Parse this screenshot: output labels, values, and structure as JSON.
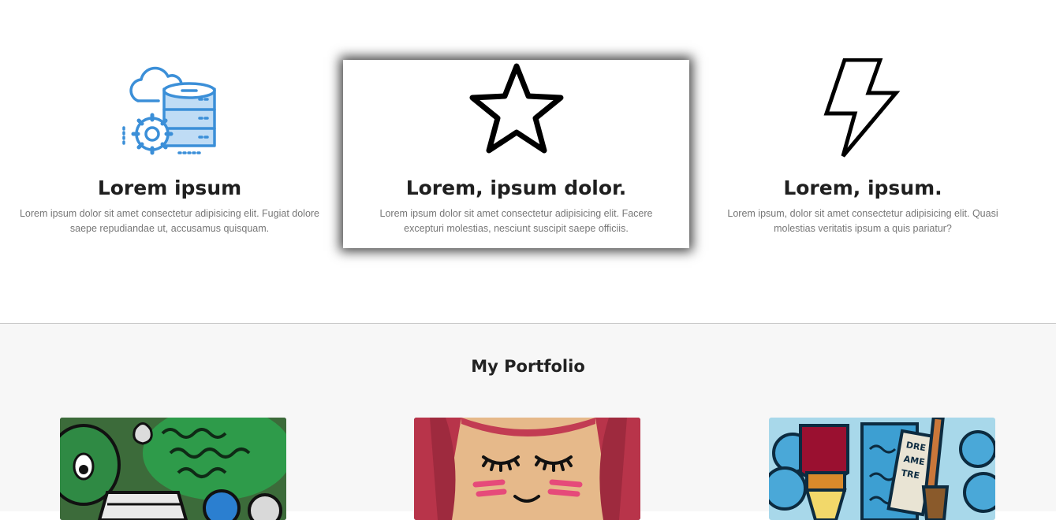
{
  "features": [
    {
      "title": "Lorem ipsum",
      "text": "Lorem ipsum dolor sit amet consectetur adipisicing elit. Fugiat dolore saepe repudiandae ut, accusamus quisquam.",
      "icon": "cloud-database-gear-icon"
    },
    {
      "title": "Lorem, ipsum dolor.",
      "text": "Lorem ipsum dolor sit amet consectetur adipisicing elit. Facere excepturi molestias, nesciunt suscipit saepe officiis.",
      "icon": "star-icon"
    },
    {
      "title": "Lorem, ipsum.",
      "text": "Lorem ipsum, dolor sit amet consectetur adipisicing elit. Quasi molestias veritatis ipsum a quis pariatur?",
      "icon": "lightning-bolt-icon"
    }
  ],
  "portfolio": {
    "title": "My Portfolio",
    "items": [
      {
        "image": "doodle-monster-illustration"
      },
      {
        "image": "girl-face-illustration"
      },
      {
        "image": "paint-tubes-brush-illustration"
      }
    ]
  },
  "colors": {
    "icon_blue": "#3b8fd8",
    "card_shadow": "#000000",
    "portfolio_bg": "#f7f7f7"
  }
}
